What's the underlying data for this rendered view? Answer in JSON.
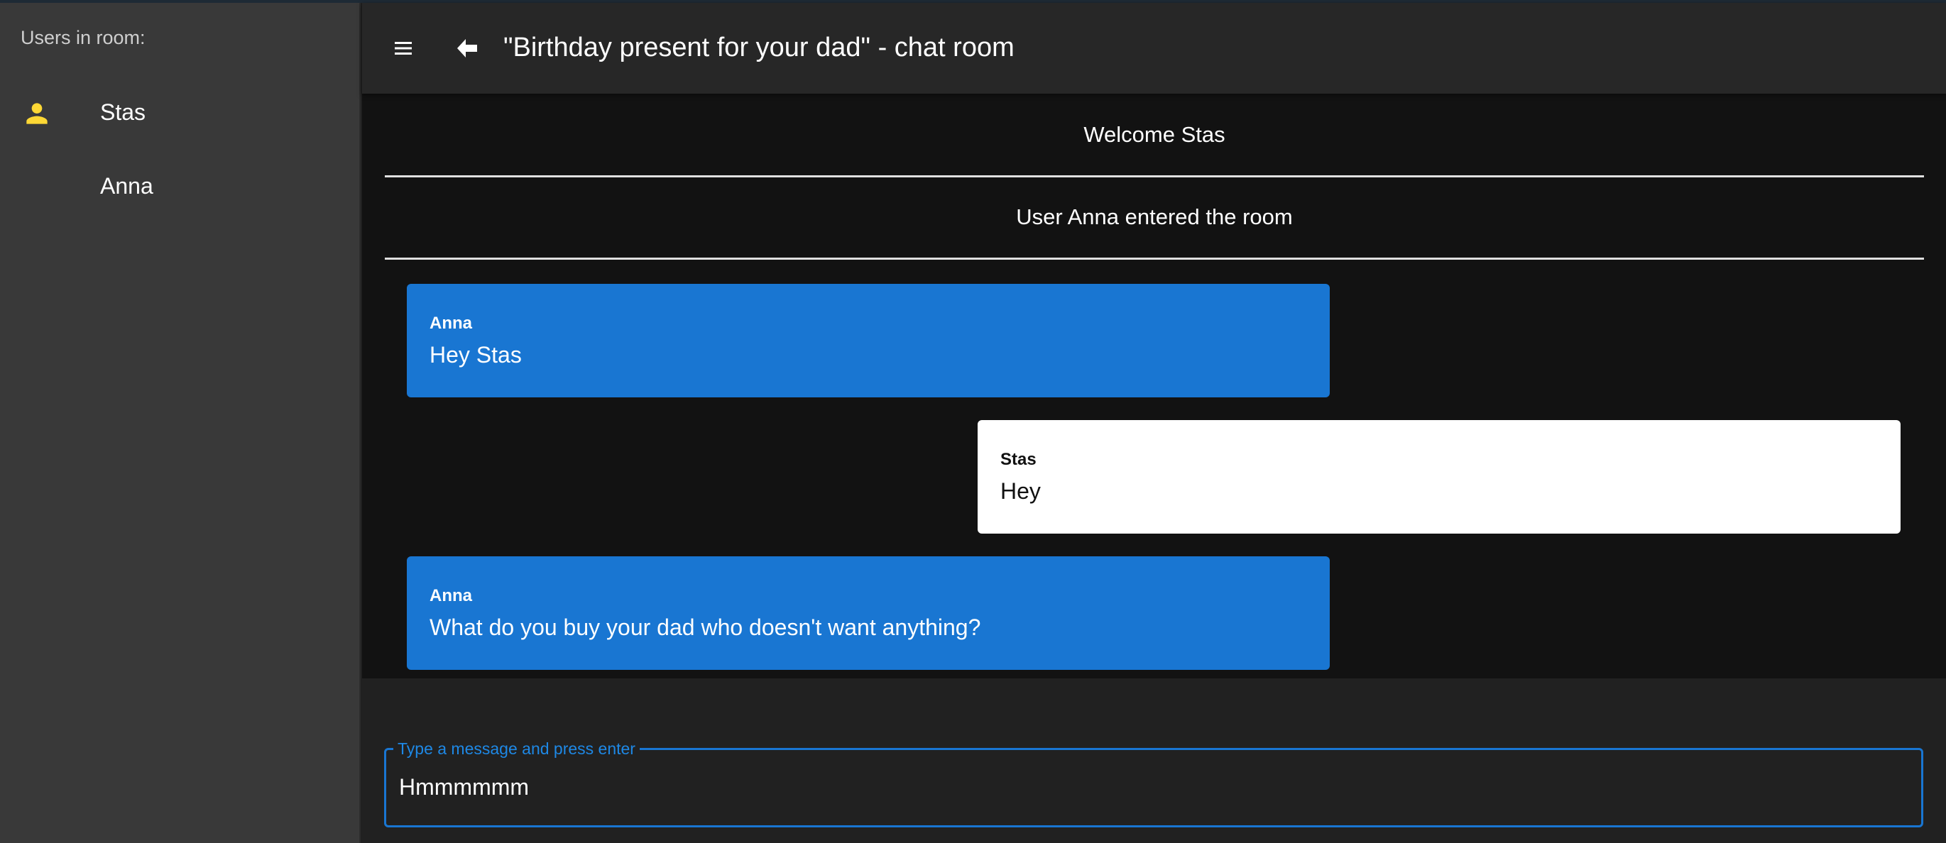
{
  "sidebar": {
    "title": "Users in room:",
    "users": [
      {
        "name": "Stas",
        "icon": "person-icon",
        "icon_color": "#fdd835"
      },
      {
        "name": "Anna"
      }
    ]
  },
  "header": {
    "title": "\"Birthday present for your dad\" - chat room",
    "menu_icon": "hamburger-menu-icon",
    "back_icon": "back-arrow-icon"
  },
  "chat": {
    "system_messages": [
      "Welcome Stas",
      "User Anna entered the room"
    ],
    "messages": [
      {
        "sender": "Anna",
        "text": "Hey Stas",
        "side": "left",
        "color": "#1976d2"
      },
      {
        "sender": "Stas",
        "text": "Hey",
        "side": "right",
        "color": "#ffffff"
      },
      {
        "sender": "Anna",
        "text": "What do you buy your dad who doesn't want anything?",
        "side": "left",
        "color": "#1976d2"
      }
    ]
  },
  "composer": {
    "label": "Type a message and press enter",
    "value": "Hmmmmmm"
  },
  "colors": {
    "accent": "#1976d2",
    "sidebar_bg": "#393939",
    "chat_bg": "#121212",
    "header_bg": "#272727"
  }
}
